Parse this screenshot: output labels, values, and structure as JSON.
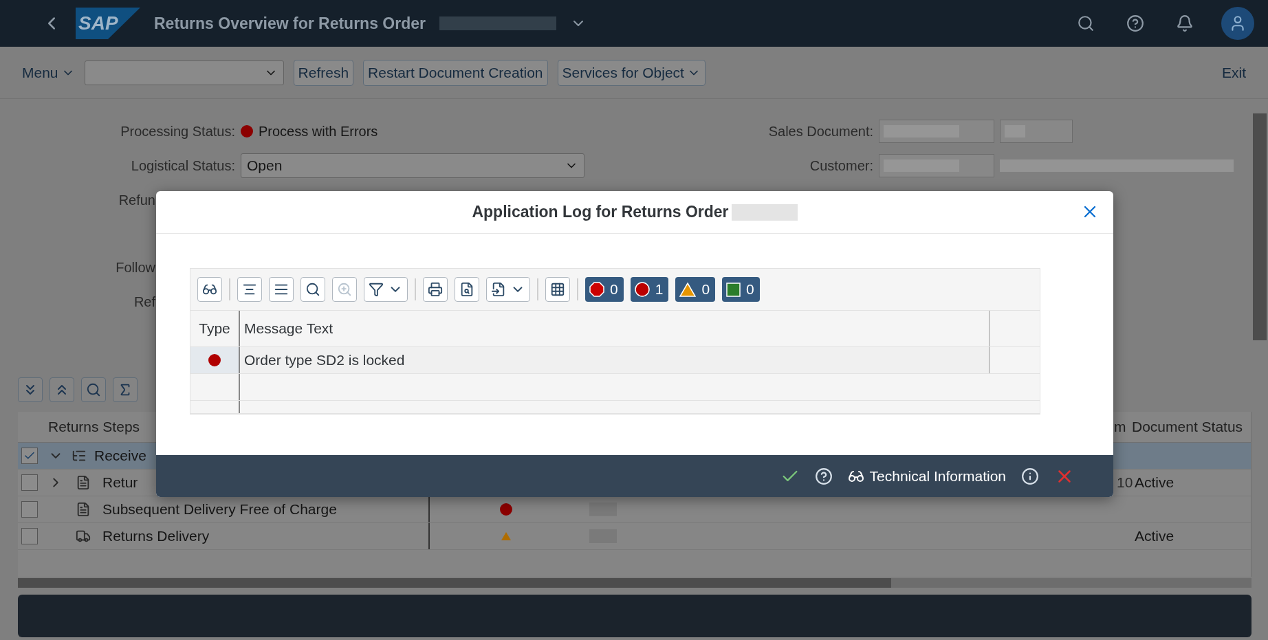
{
  "shell": {
    "logo": "SAP",
    "title": "Returns Overview for Returns Order"
  },
  "toolbar": {
    "menu": "Menu",
    "buttons": [
      "Refresh",
      "Restart Document Creation",
      "Services for Object"
    ],
    "exit": "Exit"
  },
  "form": {
    "left": [
      {
        "kind": "status",
        "label": "Processing Status:",
        "value": "Process with Errors"
      },
      {
        "kind": "select",
        "label": "Logistical Status:",
        "value": "Open"
      },
      {
        "kind": "cut",
        "label": "Refun"
      },
      {
        "kind": "cut",
        "label": "Follow"
      },
      {
        "kind": "cut",
        "label": "Ref"
      }
    ],
    "right": [
      {
        "label": "Sales Document:"
      },
      {
        "label": "Customer:"
      }
    ]
  },
  "steps_table": {
    "columns": [
      "Returns Steps",
      "m",
      "Document Status"
    ],
    "rows": [
      {
        "selected": true,
        "checked": true,
        "expanded": true,
        "kind": "group",
        "step": "Receive",
        "item": "",
        "doc_status": ""
      },
      {
        "selected": false,
        "checked": false,
        "expanded": false,
        "kind": "document",
        "step": "Retur",
        "item": "10",
        "doc_status": "Active"
      },
      {
        "selected": false,
        "checked": false,
        "kind": "document",
        "step": "Subsequent Delivery Free of Charge",
        "marker": {
          "kind": "error"
        },
        "item": "",
        "doc_status": ""
      },
      {
        "selected": false,
        "checked": false,
        "kind": "truck",
        "step": "Returns Delivery",
        "marker": {
          "kind": "warning"
        },
        "item": "",
        "doc_status": "Active"
      }
    ]
  },
  "dialog": {
    "title": "Application Log for Returns Order",
    "counters": [
      {
        "kind": "stop",
        "count": "0"
      },
      {
        "kind": "error",
        "count": "1"
      },
      {
        "kind": "warning",
        "count": "0"
      },
      {
        "kind": "success",
        "count": "0"
      }
    ],
    "columns": [
      "Type",
      "Message Text"
    ],
    "rows": [
      {
        "kind": "error",
        "text": "Order type SD2 is locked",
        "selected": true
      }
    ],
    "footer": {
      "technical_info": "Technical Information"
    }
  }
}
